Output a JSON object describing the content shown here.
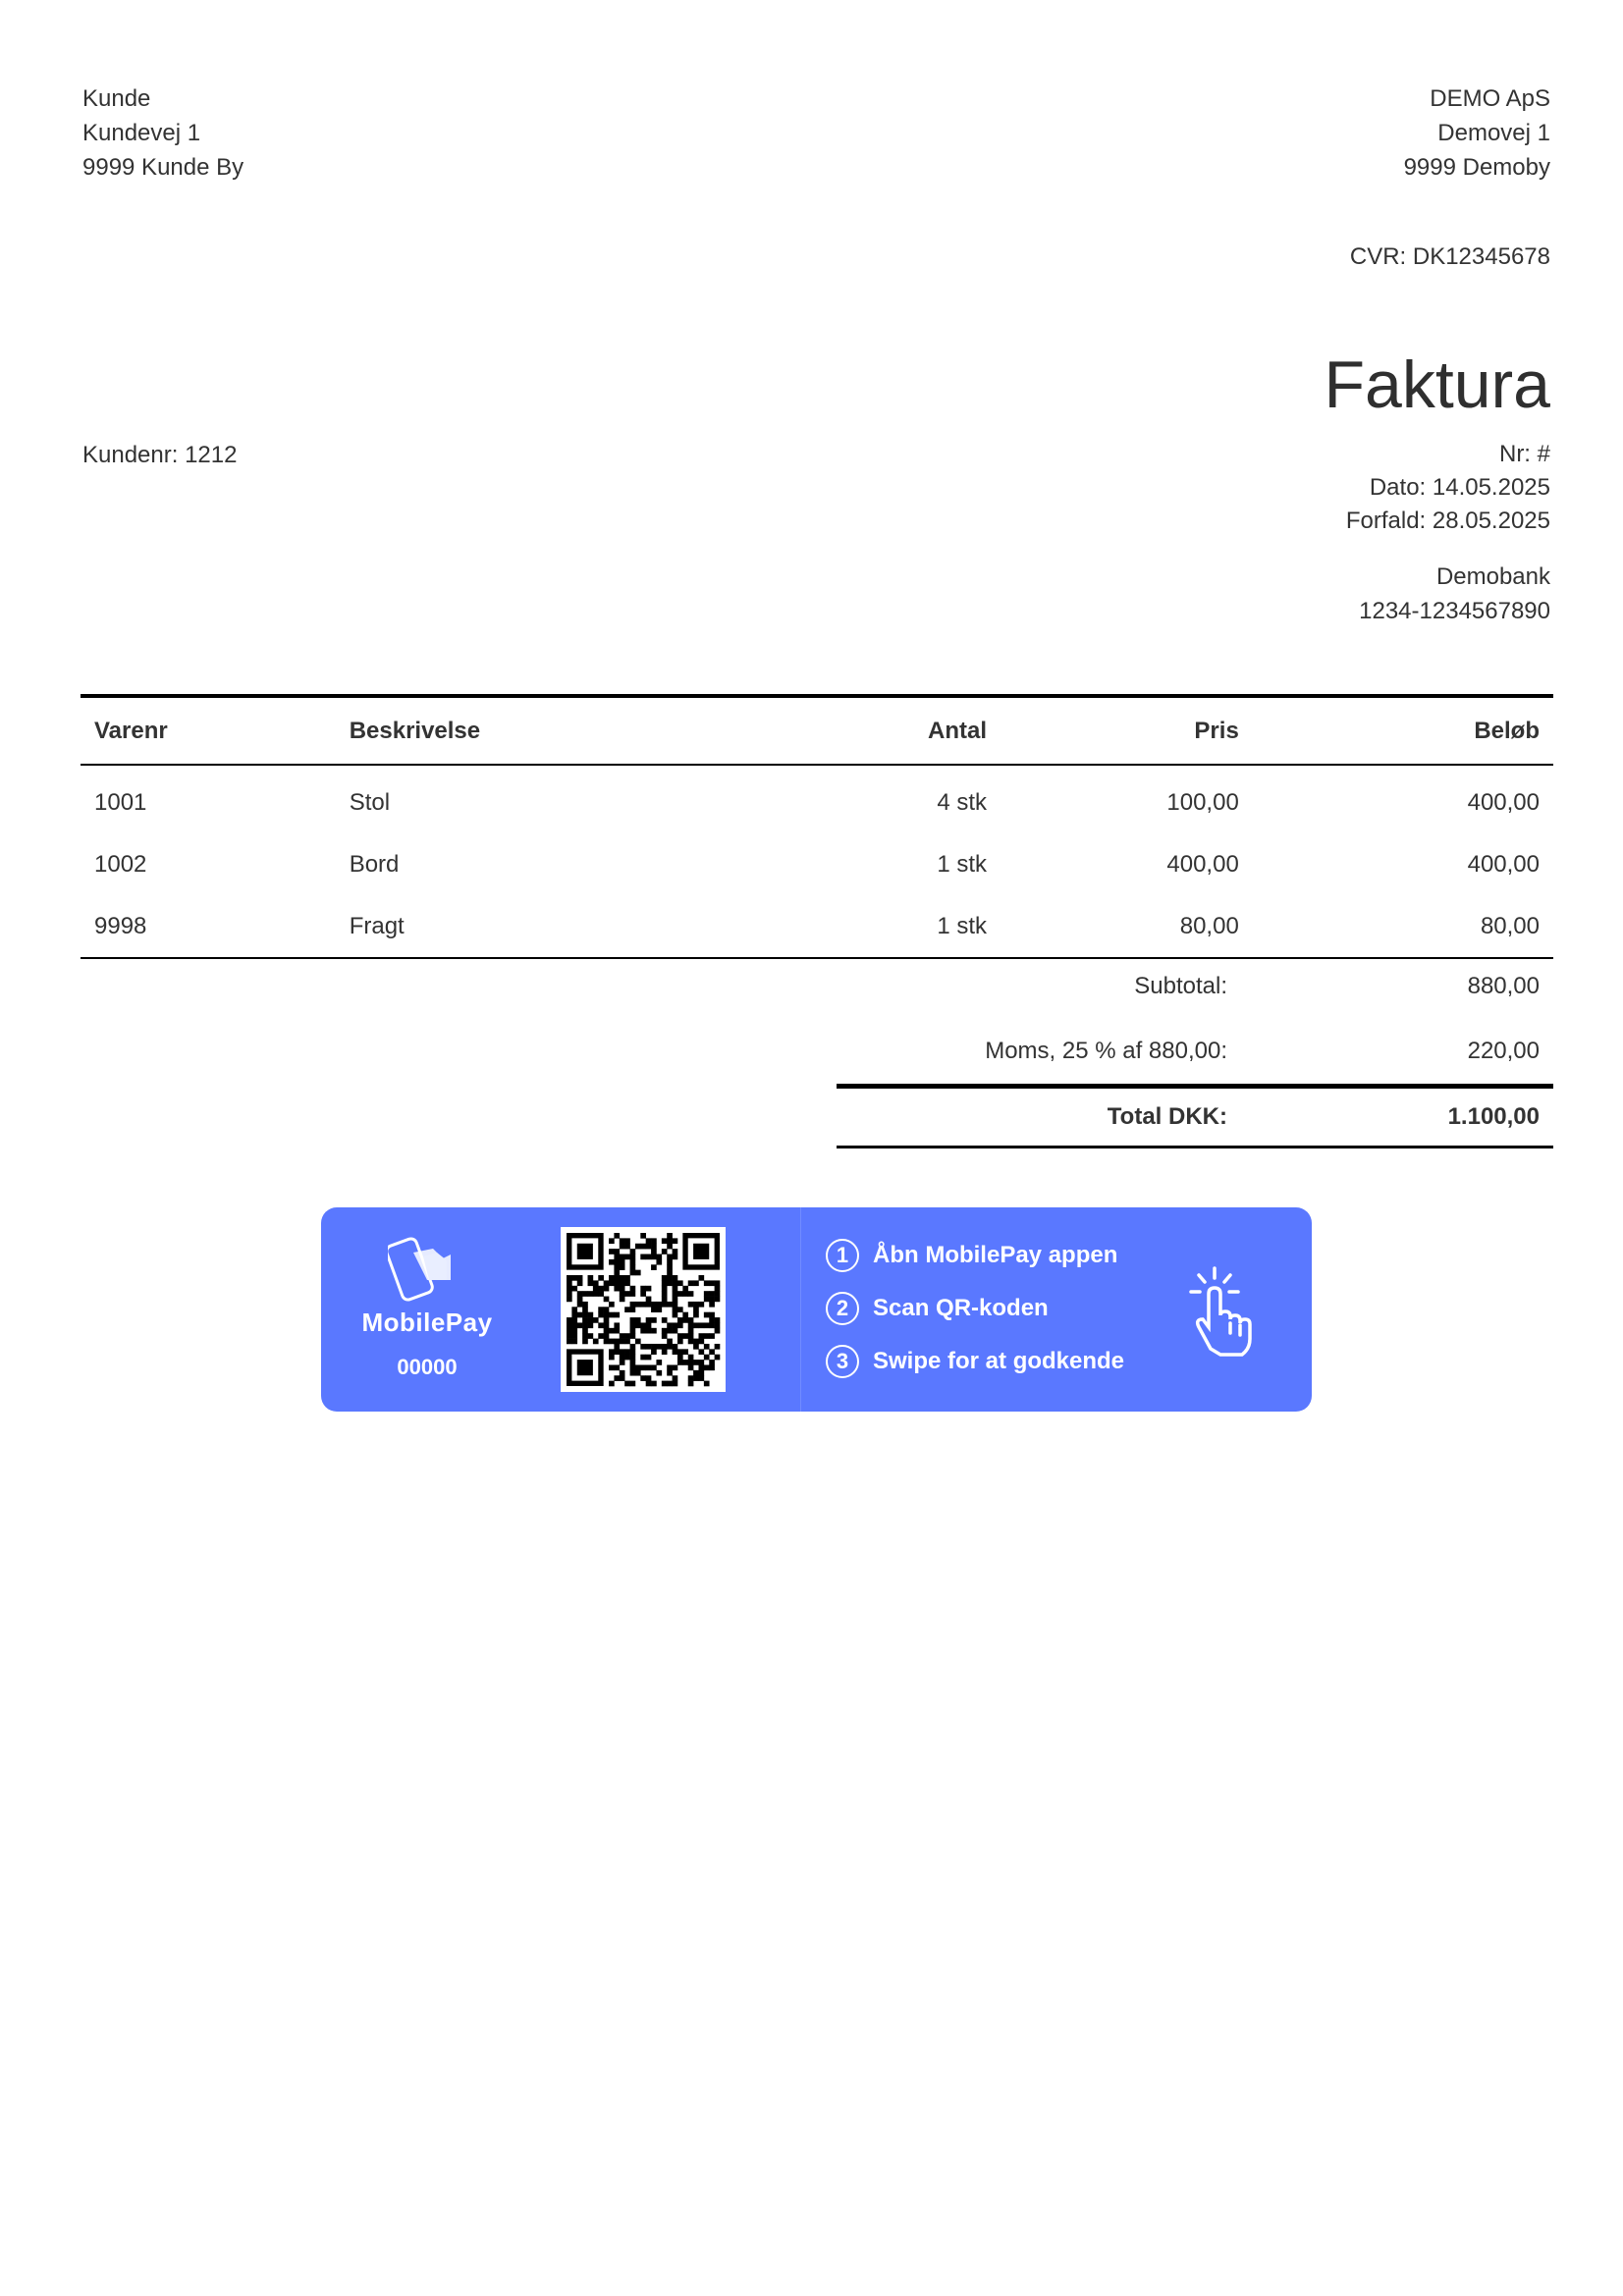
{
  "customer": {
    "name": "Kunde",
    "street": "Kundevej 1",
    "city": "9999 Kunde By",
    "number": "Kundenr: 1212"
  },
  "company": {
    "name": "DEMO ApS",
    "street": "Demovej 1",
    "city": "9999 Demoby",
    "cvr": "CVR: DK12345678"
  },
  "invoice": {
    "title": "Faktura",
    "number": "Nr: #",
    "date": "Dato: 14.05.2025",
    "due": "Forfald: 28.05.2025",
    "bank_name": "Demobank",
    "bank_account": "1234-1234567890"
  },
  "table": {
    "headers": [
      "Varenr",
      "Beskrivelse",
      "Antal",
      "Pris",
      "Beløb"
    ],
    "rows": [
      [
        "1001",
        "Stol",
        "4 stk",
        "100,00",
        "400,00"
      ],
      [
        "1002",
        "Bord",
        "1 stk",
        "400,00",
        "400,00"
      ],
      [
        "9998",
        "Fragt",
        "1 stk",
        "80,00",
        "80,00"
      ]
    ]
  },
  "totals": {
    "subtotal_label": "Subtotal:",
    "subtotal_value": "880,00",
    "vat_label": "Moms, 25 % af 880,00:",
    "vat_value": "220,00",
    "total_label": "Total DKK:",
    "total_value": "1.100,00"
  },
  "mobilepay": {
    "brand": "MobilePay",
    "number": "00000",
    "steps": [
      {
        "num": "1",
        "text": "Åbn MobilePay appen"
      },
      {
        "num": "2",
        "text": "Scan QR-koden"
      },
      {
        "num": "3",
        "text": "Swipe for at godkende"
      }
    ],
    "color": "#5a78ff",
    "icons": [
      "mobilepay-logo-icon",
      "qr-code",
      "tap-hand-icon"
    ]
  }
}
